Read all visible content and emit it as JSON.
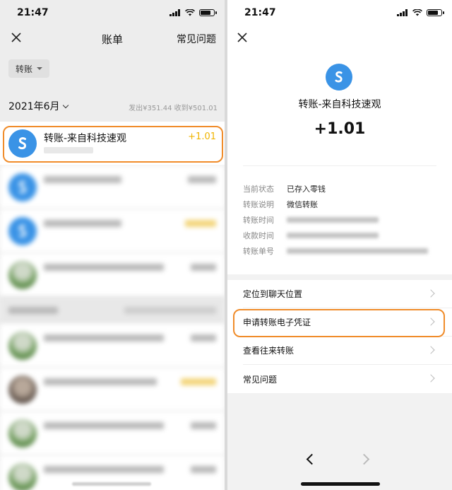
{
  "left": {
    "status": {
      "time": "21:47"
    },
    "header": {
      "title": "账单",
      "faq": "常见问题"
    },
    "filter": {
      "label": "转账"
    },
    "month": {
      "label": "2021年6月",
      "stats": "发出¥351.44  收到¥501.01"
    },
    "first_item": {
      "title": "转账-来自科技速观",
      "amount": "+1.01"
    }
  },
  "right": {
    "status": {
      "time": "21:47"
    },
    "title": "转账-来自科技速观",
    "amount": "+1.01",
    "details": [
      {
        "label": "当前状态",
        "value": "已存入零钱"
      },
      {
        "label": "转账说明",
        "value": "微信转账"
      },
      {
        "label": "转账时间",
        "value": ""
      },
      {
        "label": "收款时间",
        "value": ""
      },
      {
        "label": "转账单号",
        "value": ""
      }
    ],
    "actions": [
      {
        "label": "定位到聊天位置"
      },
      {
        "label": "申请转账电子凭证"
      },
      {
        "label": "查看往来转账"
      },
      {
        "label": "常见问题"
      }
    ]
  },
  "colors": {
    "accent_orange": "#f08c2a",
    "amount_gold": "#f0b400",
    "brand_blue": "#3a93e6"
  }
}
